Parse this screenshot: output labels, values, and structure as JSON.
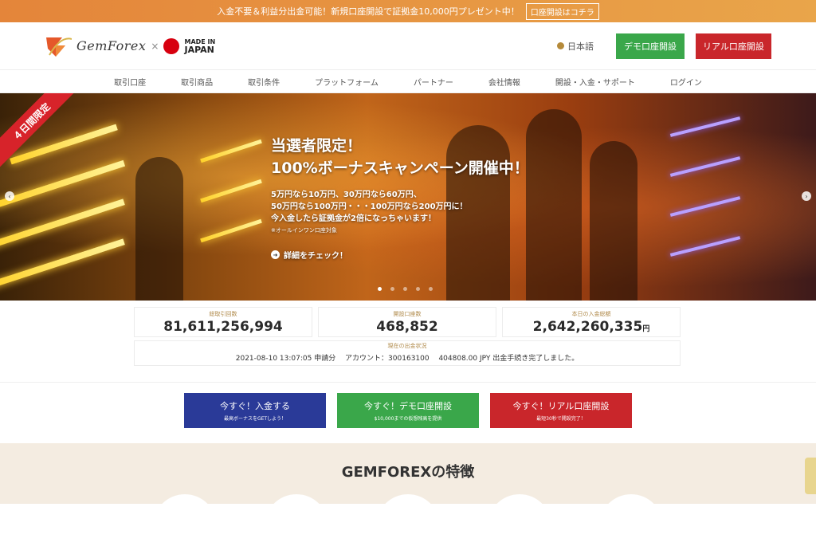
{
  "topbar": {
    "message": "入金不要＆利益分出金可能！新規口座開設で証拠金10,000円プレゼント中！",
    "cta": "口座開設はコチラ"
  },
  "header": {
    "logo_text": "GemForex",
    "logo_x": "×",
    "made_in": "MADE IN",
    "japan": "JAPAN",
    "language": "日本語",
    "demo_button": "デモ口座開設",
    "real_button": "リアル口座開設"
  },
  "nav": {
    "items": [
      "取引口座",
      "取引商品",
      "取引条件",
      "プラットフォーム",
      "パートナー",
      "会社情報",
      "開設・入金・サポート",
      "ログイン"
    ]
  },
  "hero": {
    "ribbon": "４日間限定",
    "title_1": "当選者限定！",
    "title_2": "100%ボーナスキャンペーン開催中！",
    "line_1": "5万円なら10万円、30万円なら60万円、",
    "line_2": "50万円なら100万円・・・100万円なら200万円に！",
    "line_3": "今入金したら証拠金が2倍になっちゃいます！",
    "note": "※オールインワン口座対象",
    "link": "詳細をチェック！"
  },
  "stats": {
    "total_trades_label": "総取引回数",
    "total_trades": "81,611,256,994",
    "accounts_label": "開設口座数",
    "accounts": "468,852",
    "deposit_label": "本日の入金総額",
    "deposit": "2,642,260,335",
    "deposit_unit": "円",
    "status_label": "現在の出金状況",
    "status_text": "2021-08-10 13:07:05 申請分　 アカウント：300163100　 404808.00 JPY 出金手続き完了しました。"
  },
  "cta": {
    "deposit_title": "今すぐ！入金する",
    "deposit_sub": "最高ボーナスをGETしよう！",
    "demo_title": "今すぐ！デモ口座開設",
    "demo_sub": "$10,000までの仮想残高を提供",
    "real_title": "今すぐ！リアル口座開設",
    "real_sub": "最短30秒で開設完了！"
  },
  "features": {
    "title": "GEMFOREXの特徴"
  },
  "colors": {
    "accent_orange": "#e4853a",
    "demo_green": "#3aa74a",
    "real_red": "#c9262b",
    "deposit_blue": "#2a3a98",
    "gold_label": "#b08a4a"
  },
  "icons": [
    "globe-icon",
    "chevron-left-icon",
    "chevron-right-icon",
    "arrow-circle-icon"
  ]
}
